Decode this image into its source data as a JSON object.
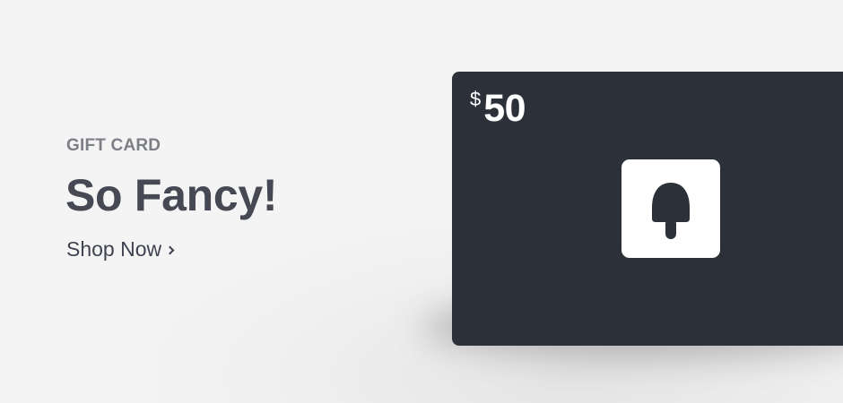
{
  "promo": {
    "eyebrow": "GIFT CARD",
    "headline": "So Fancy!",
    "cta_label": "Shop Now",
    "cta_icon": "chevron-right-icon"
  },
  "gift_card": {
    "currency_symbol": "$",
    "amount": "50",
    "logo_icon": "popsicle-icon",
    "background_color": "#2c3139",
    "text_color": "#ffffff"
  },
  "colors": {
    "page_background": "#f4f4f4",
    "eyebrow": "#7d7f86",
    "headline": "#464853",
    "cta": "#3f4250"
  }
}
